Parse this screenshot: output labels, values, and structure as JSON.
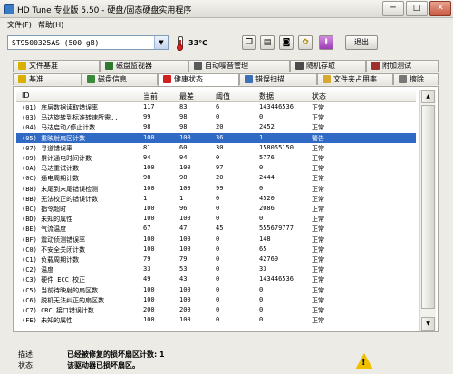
{
  "window": {
    "title": "HD Tune 专业版 5.50 - 硬盘/固态硬盘实用程序",
    "controls": [
      "─",
      "□",
      "✕"
    ]
  },
  "menu": [
    "文件(F)",
    "帮助(H)"
  ],
  "toolbar": {
    "drive": "ST9500325AS (500 gB)",
    "temperature": "33℃",
    "exit_label": "退出",
    "icons": [
      "copy-icon",
      "save-icon",
      "camera-icon",
      "settings-icon",
      "download-icon"
    ]
  },
  "tabs": {
    "row1": [
      "文件基准",
      "磁盘监视器",
      "自动噪音管理",
      "随机存取",
      "附加测试"
    ],
    "row2": [
      "基准",
      "磁盘信息",
      "健康状态",
      "错误扫描",
      "文件夹占用率",
      "擦除"
    ],
    "active": "健康状态"
  },
  "health_table": {
    "columns": [
      "ID",
      "当前",
      "最差",
      "阈值",
      "数据",
      "状态"
    ],
    "rows": [
      [
        "(01) 底层数据读取错误率",
        "117",
        "83",
        "6",
        "143446536",
        "正常"
      ],
      [
        "(03) 马达旋转到标准转速所需...",
        "99",
        "98",
        "0",
        "0",
        "正常"
      ],
      [
        "(04) 马达启动/停止计数",
        "98",
        "98",
        "20",
        "2452",
        "正常"
      ],
      [
        "(05) 重映射扇区计数",
        "100",
        "100",
        "36",
        "1",
        "警告"
      ],
      [
        "(07) 寻道错误率",
        "81",
        "60",
        "30",
        "158055150",
        "正常"
      ],
      [
        "(09) 累计通电时间计数",
        "94",
        "94",
        "0",
        "5776",
        "正常"
      ],
      [
        "(0A) 马达重试计数",
        "100",
        "100",
        "97",
        "0",
        "正常"
      ],
      [
        "(0C) 通电周期计数",
        "98",
        "98",
        "20",
        "2444",
        "正常"
      ],
      [
        "(B8) 末尾到末尾错误检测",
        "100",
        "100",
        "99",
        "0",
        "正常"
      ],
      [
        "(BB) 无法校正的错误计数",
        "1",
        "1",
        "0",
        "4520",
        "正常"
      ],
      [
        "(BC) 指令超时",
        "100",
        "96",
        "0",
        "2086",
        "正常"
      ],
      [
        "(BD) 未知的属性",
        "100",
        "100",
        "0",
        "0",
        "正常"
      ],
      [
        "(BE) 气流温度",
        "67",
        "47",
        "45",
        "555679777",
        "正常"
      ],
      [
        "(BF) 震动侦测错误率",
        "100",
        "100",
        "0",
        "148",
        "正常"
      ],
      [
        "(C0) 不安全关闭计数",
        "100",
        "100",
        "0",
        "65",
        "正常"
      ],
      [
        "(C1) 负载周期计数",
        "79",
        "79",
        "0",
        "42769",
        "正常"
      ],
      [
        "(C2) 温度",
        "33",
        "53",
        "0",
        "33",
        "正常"
      ],
      [
        "(C3) 硬件 ECC 校正",
        "49",
        "43",
        "0",
        "143446536",
        "正常"
      ],
      [
        "(C5) 当前待映射的扇区数",
        "100",
        "100",
        "0",
        "0",
        "正常"
      ],
      [
        "(C6) 脱机无法纠正的扇区数",
        "100",
        "100",
        "0",
        "0",
        "正常"
      ],
      [
        "(C7) CRC 接口错误计数",
        "200",
        "200",
        "0",
        "0",
        "正常"
      ],
      [
        "(FE) 未知的属性",
        "100",
        "100",
        "0",
        "0",
        "正常"
      ]
    ],
    "selected_row": 3
  },
  "info": {
    "desc_label": "描述:",
    "desc_value": "已经被修复的损坏扇区计数: 1",
    "status_label": "状态:",
    "status_value": "该驱动器已损坏扇区。"
  }
}
